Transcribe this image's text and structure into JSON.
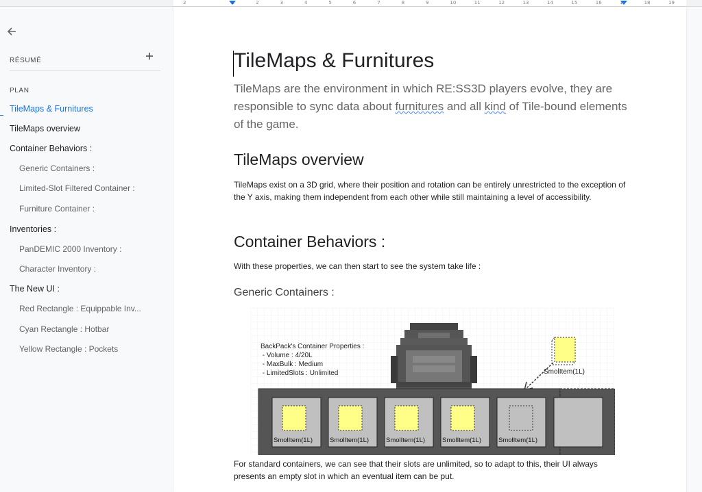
{
  "ruler": {
    "labels": [
      "2",
      "1",
      "1",
      "2",
      "3",
      "4",
      "5",
      "6",
      "7",
      "8",
      "9",
      "10",
      "11",
      "12",
      "13",
      "14",
      "15",
      "16",
      "17",
      "18",
      "19"
    ],
    "marker_color": "#1a73e8"
  },
  "sidebar": {
    "back_icon": "arrow-left-icon",
    "summary_label": "RÉSUMÉ",
    "add_icon": "plus-icon",
    "plan_label": "PLAN",
    "outline": [
      {
        "label": "TileMaps & Furnitures",
        "level": 1,
        "active": true
      },
      {
        "label": "TileMaps overview",
        "level": 1
      },
      {
        "label": "Container Behaviors :",
        "level": 1
      },
      {
        "label": "Generic Containers :",
        "level": 2
      },
      {
        "label": "Limited-Slot Filtered Container :",
        "level": 2
      },
      {
        "label": "Furniture Container :",
        "level": 2
      },
      {
        "label": "Inventories :",
        "level": 1
      },
      {
        "label": "PanDEMIC 2000 Inventory :",
        "level": 2
      },
      {
        "label": "Character Inventory :",
        "level": 2
      },
      {
        "label": "The New UI :",
        "level": 1
      },
      {
        "label": "Red Rectangle : Equippable Inv...",
        "level": 2
      },
      {
        "label": "Cyan Rectangle : Hotbar",
        "level": 2
      },
      {
        "label": "Yellow Rectangle : Pockets",
        "level": 2
      }
    ]
  },
  "doc": {
    "title": "TileMaps & Furnitures",
    "subtitle_part1": "TileMaps are the environment in which RE:SS3D players evolve, they are responsible to sync data about ",
    "subtitle_word1": "furnitures",
    "subtitle_part2": " and all ",
    "subtitle_word2": "kind",
    "subtitle_part3": " of Tile-bound elements of the game.",
    "h_overview": "TileMaps overview",
    "p_overview": "TileMaps exist on a 3D grid, where their position and rotation can be entirely unrestricted to the exception of the Y axis, making them independent from each other while still maintaining a level of accessibility.",
    "h_container": "Container Behaviors :",
    "p_container": "With these properties, we can then start to see the system take life :",
    "h_generic": "Generic Containers :",
    "p_generic": "For standard containers, we can see that their slots are unlimited, so to adapt to this, their UI always presents an empty slot in which an eventual item can be put."
  },
  "diagram": {
    "props_lines": [
      "BackPack's Container Properties :",
      " - Volume : 4/20L",
      " - MaxBulk : Medium",
      " - LimitedSlots : Unlimited"
    ],
    "slot_labels": [
      "SmolItem(1L)",
      "SmolItem(1L)",
      "SmolItem(1L)",
      "SmolItem(1L)",
      "SmolItem(1L)"
    ],
    "floating_item_label": "SmolItem(1L)",
    "item_color": "#ffff88",
    "container_color": "#555555",
    "slot_color": "#c0c0c0"
  }
}
